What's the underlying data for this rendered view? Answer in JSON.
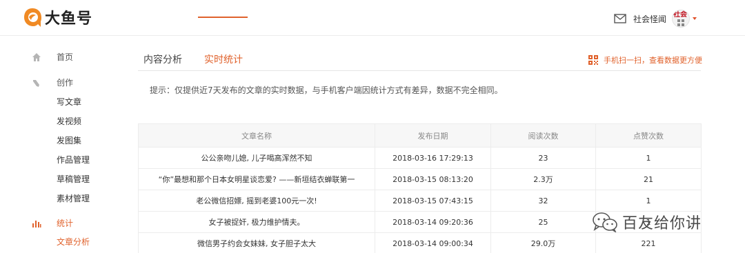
{
  "header": {
    "logo_text": "大鱼号",
    "user_name": "社会怪闻",
    "avatar_text": "社会"
  },
  "sidebar": {
    "home": "首页",
    "create": "创作",
    "create_items": [
      "写文章",
      "发视频",
      "发图集",
      "作品管理",
      "草稿管理",
      "素材管理"
    ],
    "stats": "统计",
    "stats_items": [
      "文章分析"
    ]
  },
  "tabs": {
    "content_analysis": "内容分析",
    "realtime_stats": "实时统计"
  },
  "qr_link": "手机扫一扫，查看数据更方便",
  "tip": "提示：仅提供近7天发布的文章的实时数据，与手机客户端因统计方式有差异，数据不完全相同。",
  "table": {
    "headers": [
      "文章名称",
      "发布日期",
      "阅读次数",
      "点赞次数"
    ],
    "rows": [
      [
        "公公亲吻儿媳, 儿子喝高浑然不知",
        "2018-03-16 17:29:13",
        "23",
        "1"
      ],
      [
        "“你”最想和那个日本女明星谈恋爱? ——新垣结衣蝉联第一",
        "2018-03-15 08:13:20",
        "2.3万",
        "21"
      ],
      [
        "老公微信招嫖, 摇到老婆100元一次!",
        "2018-03-15 07:43:15",
        "32",
        "1"
      ],
      [
        "女子被捉奸, 极力维护情夫。",
        "2018-03-14 09:20:36",
        "25",
        "1"
      ],
      [
        "微信男子约会女妹妹, 女子胆子太大",
        "2018-03-14 09:00:34",
        "29.0万",
        "221"
      ]
    ]
  },
  "watermark": "百友给你讲",
  "colors": {
    "accent": "#e0612b",
    "logo_orange": "#f08a24"
  }
}
